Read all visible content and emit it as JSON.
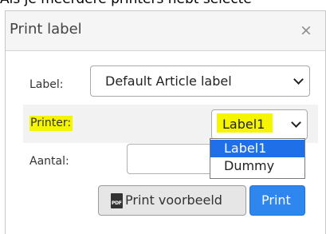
{
  "caption": "Als je meerdere printers hebt selecte",
  "dialog": {
    "title": "Print label",
    "close_symbol": "×"
  },
  "form": {
    "label_field": {
      "label": "Label:",
      "value": "Default Article label"
    },
    "printer_field": {
      "label": "Printer:",
      "value": "Label1",
      "options": [
        "Label1",
        "Dummy"
      ],
      "selected_index": 0
    },
    "amount_field": {
      "label": "Aantal:",
      "value": ""
    }
  },
  "buttons": {
    "preview_label": "Print voorbeeld",
    "preview_icon_text": "PDF",
    "print_label": "Print"
  },
  "colors": {
    "highlight": "#f5f500",
    "primary": "#2e86ee",
    "option_selected": "#1e6fe8"
  },
  "icons": {
    "close": "close-icon",
    "chevron": "chevron-down-icon",
    "pdf": "pdf-file-icon"
  }
}
